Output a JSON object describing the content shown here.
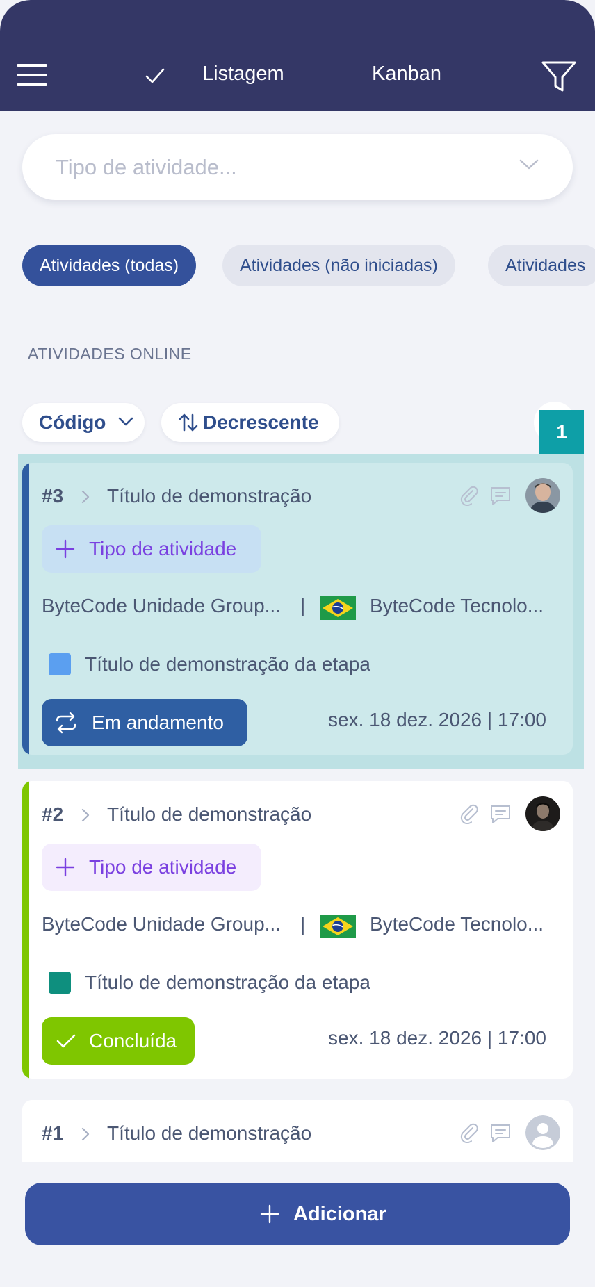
{
  "header": {
    "tab_listagem": "Listagem",
    "tab_kanban": "Kanban"
  },
  "search": {
    "placeholder": "Tipo de atividade..."
  },
  "filter_chips": [
    {
      "label": "Atividades (todas)",
      "selected": true
    },
    {
      "label": "Atividades (não iniciadas)",
      "selected": false
    },
    {
      "label": "Atividades",
      "selected": false
    }
  ],
  "section": {
    "label": "ATIVIDADES ONLINE"
  },
  "sort": {
    "field_label": "Código",
    "direction_label": "Decrescente"
  },
  "count_badge": "1",
  "cards": [
    {
      "number": "#3",
      "title": "Título de demonstração",
      "type_label": "Tipo de atividade",
      "unit": "ByteCode Unidade Group...",
      "separator": "|",
      "company": "ByteCode Tecnolo...",
      "stage_color": "#5b9ff0",
      "stage": "Título de demonstração da etapa",
      "status": "Em andamento",
      "status_color": "#2f5fa3",
      "date": "sex. 18 dez. 2026 | 17:00"
    },
    {
      "number": "#2",
      "title": "Título de demonstração",
      "type_label": "Tipo de atividade",
      "unit": "ByteCode Unidade Group...",
      "separator": "|",
      "company": "ByteCode Tecnolo...",
      "stage_color": "#0e8f7e",
      "stage": "Título de demonstração da etapa",
      "status": "Concluída",
      "status_color": "#7fc600",
      "date": "sex. 18 dez. 2026 | 17:00"
    },
    {
      "number": "#1",
      "title": "Título de demonstração"
    }
  ],
  "add_button": {
    "label": "Adicionar"
  },
  "colors": {
    "header_bg": "#343766",
    "primary": "#3953a2",
    "teal": "#0e9fa7",
    "accent_purple": "#7a40e0"
  }
}
